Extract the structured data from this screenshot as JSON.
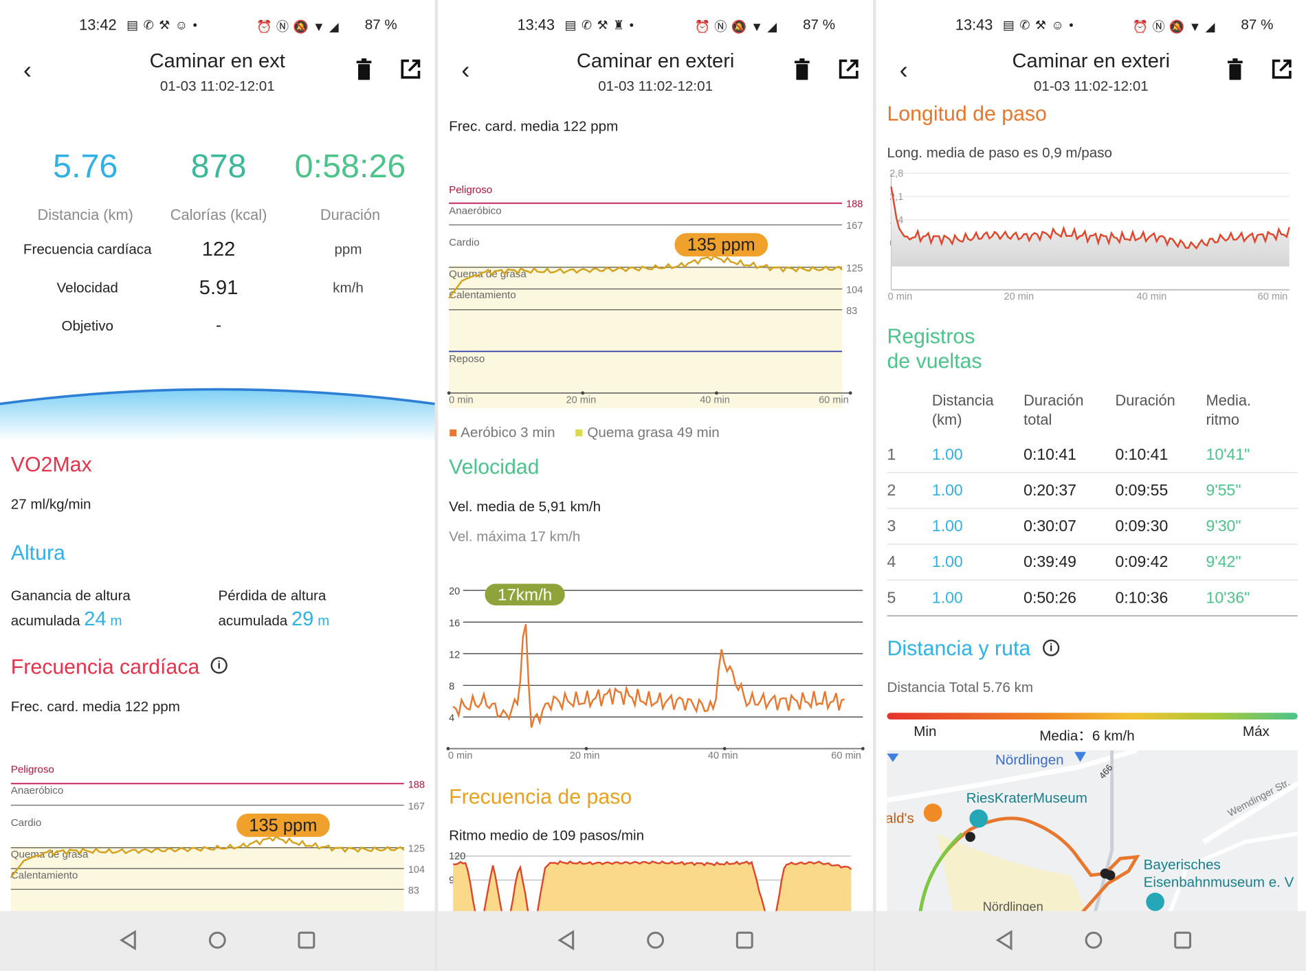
{
  "status": [
    {
      "time": "13:42",
      "battery": "87 %"
    },
    {
      "time": "13:43",
      "battery": "87 %"
    },
    {
      "time": "13:43",
      "battery": "87 %"
    }
  ],
  "header": {
    "titles": [
      "Caminar en ext",
      "Caminar en exteri",
      "Caminar en exteri"
    ],
    "date": "01-03 11:02-12:01"
  },
  "summary": {
    "distance_value": "5.76",
    "distance_label": "Distancia (km)",
    "calories_value": "878",
    "calories_label": "Calorías (kcal)",
    "duration_value": "0:58:26",
    "duration_label": "Duración",
    "rows": [
      {
        "label": "Frecuencia cardíaca",
        "value": "122",
        "unit": "ppm"
      },
      {
        "label": "Velocidad",
        "value": "5.91",
        "unit": "km/h"
      },
      {
        "label": "Objetivo",
        "value": "-",
        "unit": ""
      }
    ]
  },
  "vo2": {
    "title": "VO2Max",
    "value": "27 ml/kg/min"
  },
  "altura": {
    "title": "Altura",
    "gain_label1": "Ganancia de altura",
    "gain_label2": "acumulada",
    "gain_value": "24",
    "gain_unit": "m",
    "loss_label1": "Pérdida de altura",
    "loss_label2": "acumulada",
    "loss_value": "29",
    "loss_unit": "m"
  },
  "hr": {
    "title": "Frecuencia cardíaca",
    "avg": "Frec. card. media 122 ppm",
    "bubble": "135 ppm",
    "zones": [
      "Peligroso",
      "Anaeróbico",
      "Cardio",
      "Quema de grasa",
      "Calentamiento",
      "Reposo"
    ],
    "thresholds": [
      "188",
      "167",
      "125",
      "104",
      "83"
    ],
    "legend1": "Aeróbico 3 min",
    "legend2": "Quema grasa 49 min"
  },
  "time_ticks": [
    "0 min",
    "20 min",
    "40 min",
    "60 min"
  ],
  "speed": {
    "title": "Velocidad",
    "avg": "Vel. media de 5,91 km/h",
    "max": "Vel. máxima 17 km/h",
    "bubble": "17km/h",
    "yticks": [
      "20",
      "16",
      "12",
      "8",
      "4"
    ]
  },
  "cadence": {
    "title": "Frecuencia de paso",
    "avg": "Ritmo medio de 109 pasos/min",
    "yticks": [
      "120",
      "90"
    ]
  },
  "stride": {
    "title": "Longitud de paso",
    "avg": "Long. media de paso es 0,9 m/paso",
    "yticks": [
      "2,8",
      "2,1",
      "1,4",
      "0,7"
    ]
  },
  "laps": {
    "title1": "Registros",
    "title2": "de vueltas",
    "headers": [
      [
        "Distancia",
        "(km)"
      ],
      [
        "Duración",
        "total"
      ],
      [
        "Duración",
        ""
      ],
      [
        "Media.",
        "ritmo"
      ]
    ],
    "rows": [
      [
        "1",
        "1.00",
        "0:10:41",
        "0:10:41",
        "10'41\""
      ],
      [
        "2",
        "1.00",
        "0:20:37",
        "0:09:55",
        "9'55\""
      ],
      [
        "3",
        "1.00",
        "0:30:07",
        "0:09:30",
        "9'30\""
      ],
      [
        "4",
        "1.00",
        "0:39:49",
        "0:09:42",
        "9'42\""
      ],
      [
        "5",
        "1.00",
        "0:50:26",
        "0:10:36",
        "10'36\""
      ]
    ]
  },
  "route": {
    "title": "Distancia y ruta",
    "total": "Distancia Total 5.76 km",
    "min": "Min",
    "mid": "Media：6 km/h",
    "max": "Máx",
    "map_labels": [
      "Nördlingen",
      "RiesKraterMuseum",
      "ald's",
      "Bayerisches",
      "Eisenbahnmuseum e. V",
      "Wemdinger Str.",
      "466",
      "Nördlingen"
    ]
  },
  "colors": {
    "blue": "#2fb1e6",
    "teal": "#3bb89a",
    "green": "#4cc38a",
    "red": "#e5334b",
    "orange": "#e8762c",
    "amber": "#e8a020",
    "hrline": "#d4a01a",
    "zonefill": "#fbf8df"
  },
  "chart_data": [
    {
      "type": "line",
      "title": "Frecuencia cardíaca",
      "xlabel": "",
      "ylabel": "",
      "x": [
        0,
        2,
        5,
        10,
        15,
        20,
        25,
        30,
        35,
        40,
        45,
        50,
        55,
        60
      ],
      "y": [
        95,
        112,
        120,
        122,
        121,
        122,
        123,
        124,
        126,
        135,
        128,
        124,
        123,
        124
      ],
      "thresholds": [
        188,
        167,
        125,
        104,
        83
      ],
      "xlim": [
        0,
        60
      ]
    },
    {
      "type": "line",
      "title": "Velocidad",
      "x": [
        0,
        5,
        8,
        10,
        11,
        12,
        15,
        20,
        25,
        30,
        35,
        40,
        41,
        45,
        50,
        55,
        60
      ],
      "y": [
        5,
        6,
        4,
        6,
        17,
        3,
        6,
        6,
        7,
        6,
        6,
        5,
        12,
        6,
        6,
        6,
        6
      ],
      "ylim": [
        4,
        20
      ],
      "xlim": [
        0,
        60
      ]
    },
    {
      "type": "area",
      "title": "Frecuencia de paso",
      "x": [
        0,
        2,
        4,
        6,
        8,
        10,
        12,
        14,
        16,
        20,
        30,
        40,
        45,
        48,
        50,
        55,
        60
      ],
      "y": [
        110,
        112,
        20,
        110,
        20,
        112,
        20,
        110,
        112,
        111,
        112,
        110,
        112,
        20,
        110,
        112,
        105
      ],
      "ylim": [
        0,
        120
      ]
    },
    {
      "type": "area",
      "title": "Longitud de paso",
      "x": [
        0,
        1,
        2,
        5,
        10,
        15,
        20,
        25,
        30,
        35,
        40,
        45,
        50,
        55,
        60
      ],
      "y": [
        2.4,
        1.2,
        0.9,
        0.9,
        0.8,
        0.95,
        0.9,
        1.0,
        0.9,
        0.85,
        0.9,
        0.6,
        0.85,
        0.9,
        1.0
      ],
      "ylim": [
        0,
        2.8
      ],
      "xlim": [
        0,
        60
      ]
    }
  ]
}
